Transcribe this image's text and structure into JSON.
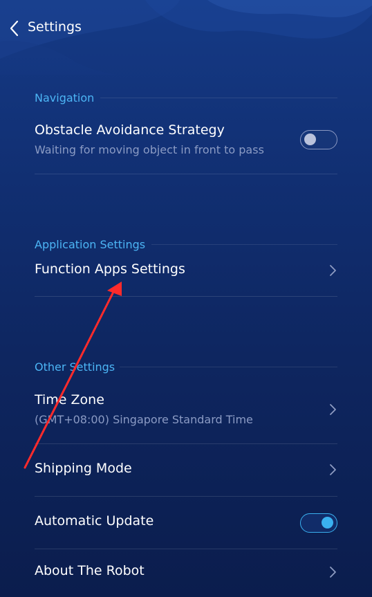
{
  "header": {
    "title": "Settings",
    "back_icon": "chevron-left-icon"
  },
  "sections": {
    "navigation": {
      "title": "Navigation",
      "obstacle": {
        "title": "Obstacle Avoidance Strategy",
        "subtitle": "Waiting for moving object in front to pass",
        "toggle_on": false
      }
    },
    "application": {
      "title": "Application Settings",
      "function_apps": {
        "title": "Function Apps Settings"
      }
    },
    "other": {
      "title": "Other Settings",
      "time_zone": {
        "title": "Time Zone",
        "subtitle": "(GMT+08:00) Singapore Standard Time"
      },
      "shipping_mode": {
        "title": "Shipping Mode"
      },
      "automatic_update": {
        "title": "Automatic Update",
        "toggle_on": true
      },
      "about": {
        "title": "About The Robot"
      }
    }
  },
  "colors": {
    "accent": "#4cb5f5",
    "toggle_on": "#3ab1f0",
    "annotation_arrow": "#ff2b2b"
  }
}
